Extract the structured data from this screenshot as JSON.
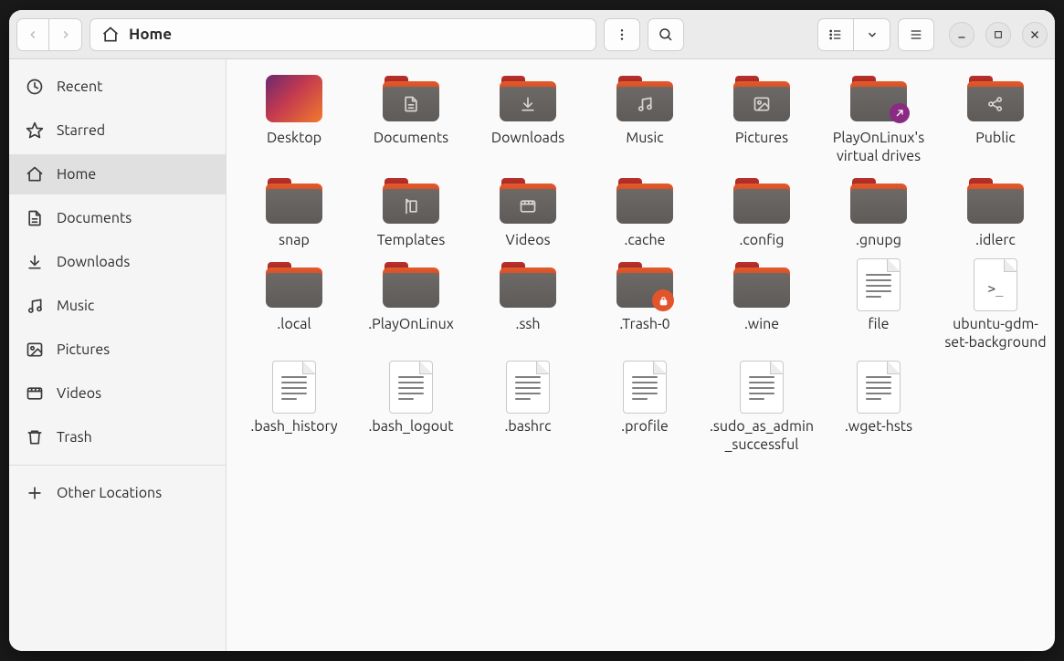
{
  "path": {
    "label": "Home"
  },
  "sidebar": {
    "items": [
      {
        "id": "recent",
        "label": "Recent",
        "icon": "clock"
      },
      {
        "id": "starred",
        "label": "Starred",
        "icon": "star"
      },
      {
        "id": "home",
        "label": "Home",
        "icon": "home",
        "active": true
      },
      {
        "id": "documents",
        "label": "Documents",
        "icon": "doc"
      },
      {
        "id": "downloads",
        "label": "Downloads",
        "icon": "download"
      },
      {
        "id": "music",
        "label": "Music",
        "icon": "music"
      },
      {
        "id": "pictures",
        "label": "Pictures",
        "icon": "picture"
      },
      {
        "id": "videos",
        "label": "Videos",
        "icon": "video"
      },
      {
        "id": "trash",
        "label": "Trash",
        "icon": "trash"
      }
    ],
    "other": {
      "label": "Other Locations",
      "icon": "plus"
    }
  },
  "items": [
    {
      "name": "Desktop",
      "kind": "desktop"
    },
    {
      "name": "Documents",
      "kind": "folder",
      "glyph": "doc"
    },
    {
      "name": "Downloads",
      "kind": "folder",
      "glyph": "download"
    },
    {
      "name": "Music",
      "kind": "folder",
      "glyph": "music"
    },
    {
      "name": "Pictures",
      "kind": "folder",
      "glyph": "picture"
    },
    {
      "name": "PlayOnLinux's virtual drives",
      "kind": "folder",
      "link": true
    },
    {
      "name": "Public",
      "kind": "folder",
      "glyph": "share"
    },
    {
      "name": "snap",
      "kind": "folder"
    },
    {
      "name": "Templates",
      "kind": "folder",
      "glyph": "templates"
    },
    {
      "name": "Videos",
      "kind": "folder",
      "glyph": "video"
    },
    {
      "name": ".cache",
      "kind": "folder"
    },
    {
      "name": ".config",
      "kind": "folder"
    },
    {
      "name": ".gnupg",
      "kind": "folder"
    },
    {
      "name": ".idlerc",
      "kind": "folder"
    },
    {
      "name": ".local",
      "kind": "folder"
    },
    {
      "name": ".PlayOnLinux",
      "kind": "folder"
    },
    {
      "name": ".ssh",
      "kind": "folder"
    },
    {
      "name": ".Trash-0",
      "kind": "folder",
      "locked": true
    },
    {
      "name": ".wine",
      "kind": "folder"
    },
    {
      "name": "file",
      "kind": "text"
    },
    {
      "name": "ubuntu-gdm-set-background",
      "kind": "script"
    },
    {
      "name": ".bash_history",
      "kind": "text"
    },
    {
      "name": ".bash_logout",
      "kind": "text"
    },
    {
      "name": ".bashrc",
      "kind": "text"
    },
    {
      "name": ".profile",
      "kind": "text"
    },
    {
      "name": ".sudo_as_admin_successful",
      "kind": "text"
    },
    {
      "name": ".wget-hsts",
      "kind": "text"
    }
  ]
}
